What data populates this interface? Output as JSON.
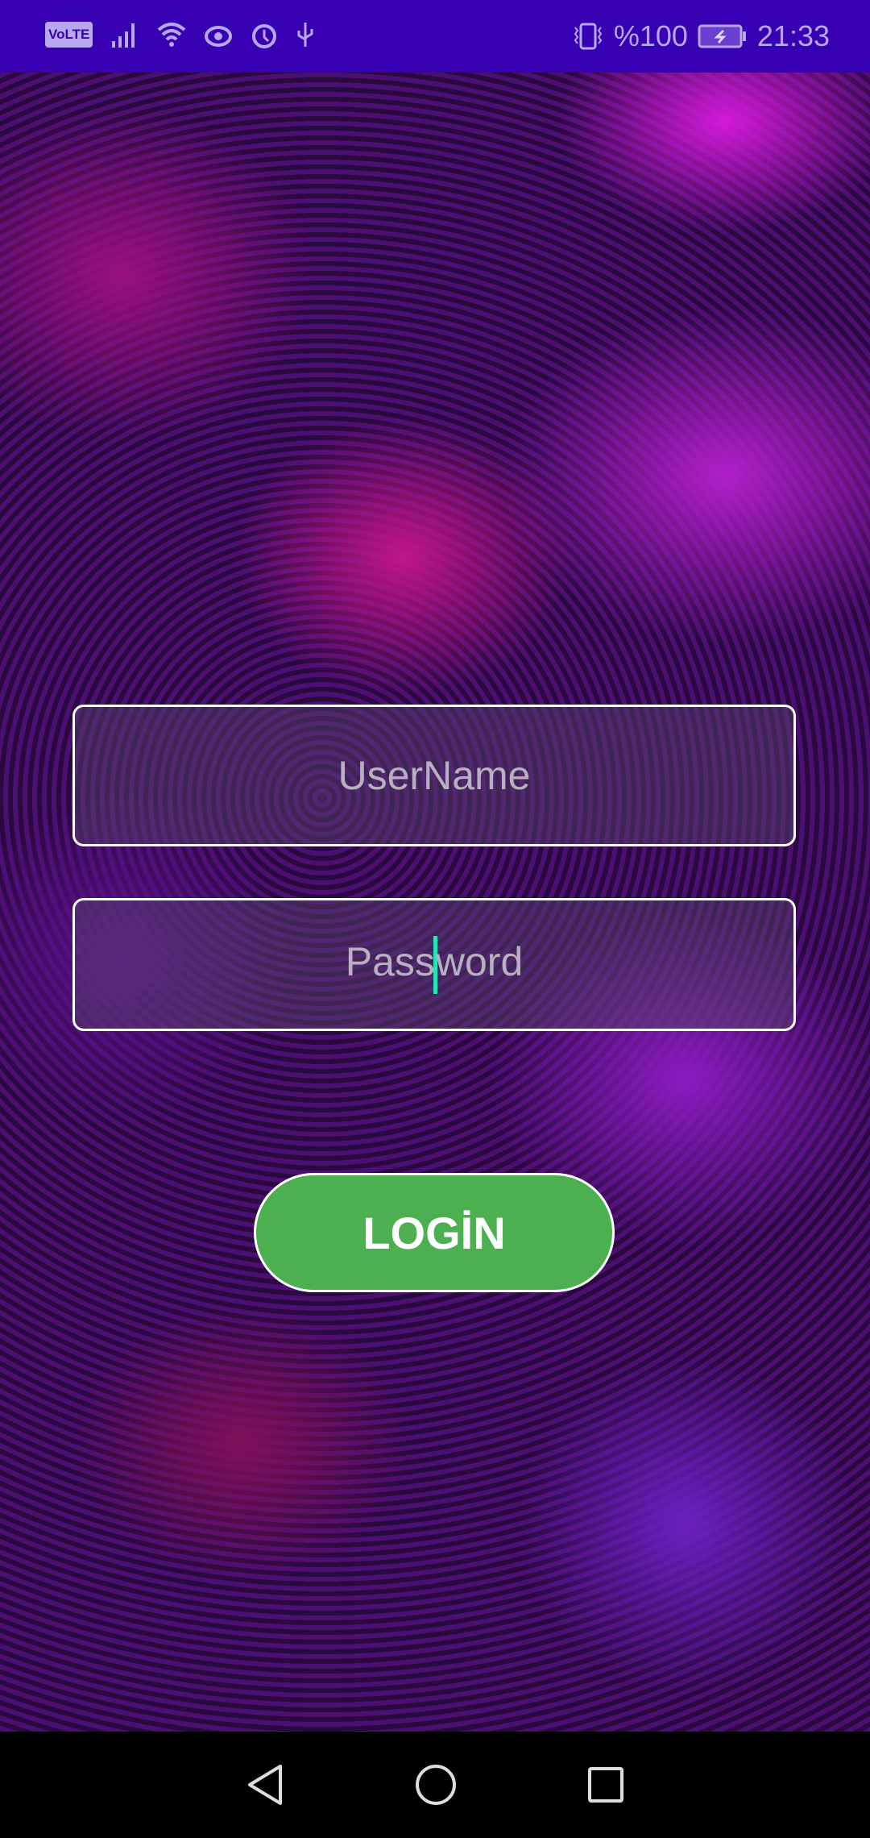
{
  "status_bar": {
    "network_badge": "VoLTE",
    "battery_percent": "%100",
    "time": "21:33",
    "background_color": "#3700B3",
    "icons": [
      "volte-icon",
      "signal-icon",
      "wifi-icon",
      "eye-icon",
      "alarm-icon",
      "usb-icon",
      "vibrate-icon",
      "battery-charging-icon"
    ]
  },
  "form": {
    "username_placeholder": "UserName",
    "password_placeholder_start": "Pass",
    "password_placeholder_end": "word",
    "login_label": "LOGİN",
    "login_color": "#4CAF50",
    "cursor_color": "#1de9b6"
  },
  "nav_bar": {
    "icons": [
      "back-icon",
      "home-icon",
      "recents-icon"
    ]
  }
}
